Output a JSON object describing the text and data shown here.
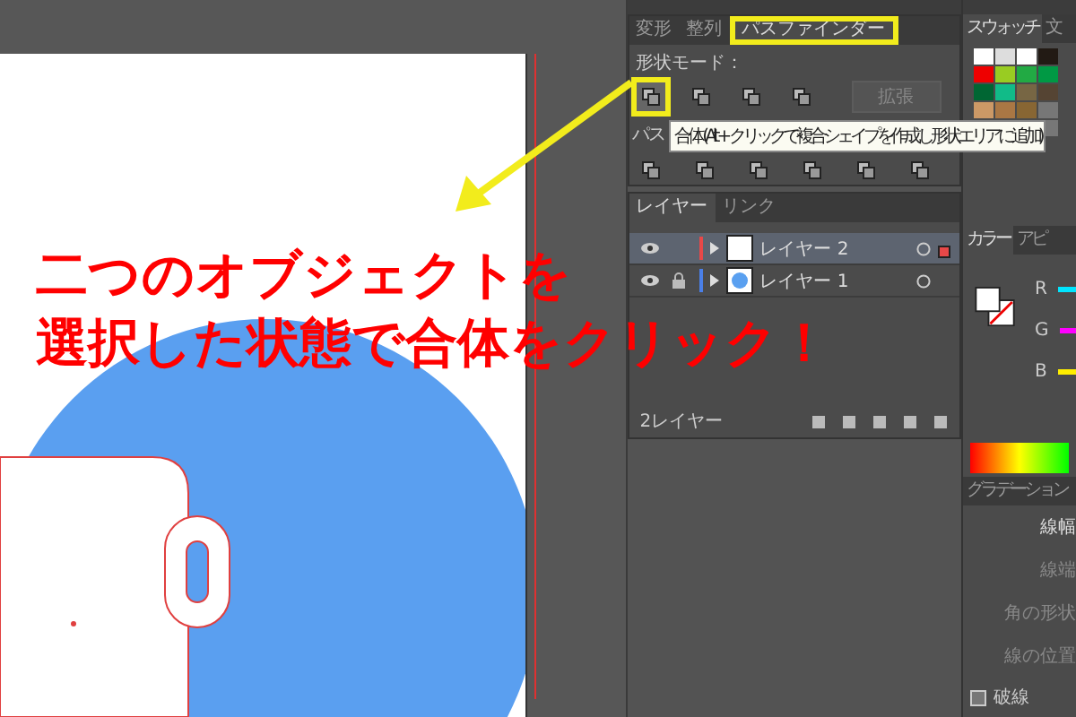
{
  "pathfinder_panel": {
    "tabs": [
      {
        "label": "変形",
        "selected": false
      },
      {
        "label": "整列",
        "selected": false
      },
      {
        "label": "パスファインダー",
        "selected": true
      }
    ],
    "shape_modes_label": "形状モード：",
    "expand_button": "拡張",
    "pathfinders_label": "パス"
  },
  "tooltip": "合体 (Alt + クリックで複合シェイプを作成し形状エリアに追加)",
  "layers_panel": {
    "tabs": [
      {
        "label": "レイヤー",
        "selected": true
      },
      {
        "label": "リンク",
        "selected": false
      }
    ],
    "layers": [
      {
        "name": "レイヤー 2",
        "selected": true,
        "locked": false,
        "color": "#e84848",
        "kind": "blank"
      },
      {
        "name": "レイヤー 1",
        "selected": false,
        "locked": true,
        "color": "#4a7fe8",
        "kind": "circle"
      }
    ],
    "footer": "2レイヤー"
  },
  "swatches_panel": {
    "tabs": [
      {
        "label": "スウォッチ",
        "selected": true
      },
      {
        "label": "文",
        "selected": false
      }
    ]
  },
  "color_panel": {
    "tabs": [
      {
        "label": "カラー",
        "selected": true
      },
      {
        "label": "アピ",
        "selected": false
      }
    ],
    "channels": [
      {
        "label": "R",
        "color": "#00e5ff"
      },
      {
        "label": "G",
        "color": "#ff00ff"
      },
      {
        "label": "B",
        "color": "#ffee00"
      }
    ]
  },
  "gradient_panel": {
    "tab": "グラデーション"
  },
  "stroke_panel": {
    "labels": [
      "線幅",
      "線端",
      "角の形状",
      "線の位置"
    ],
    "dashed_label": "破線"
  },
  "annotation": {
    "lines": [
      "二つのオブジェクトを",
      "選択した状態で合体をクリック！"
    ]
  }
}
